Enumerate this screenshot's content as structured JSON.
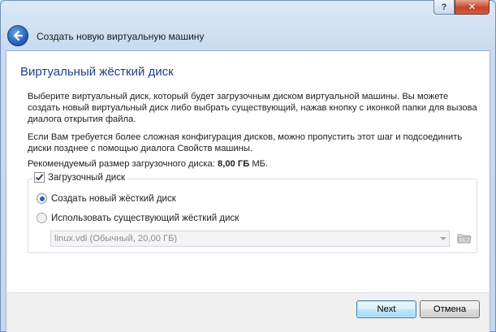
{
  "window": {
    "help_label": "?",
    "close_label": "✕"
  },
  "header": {
    "title": "Создать новую виртуальную машину",
    "back_icon": "back-arrow-icon"
  },
  "page": {
    "title": "Виртуальный жёсткий диск",
    "description1": "Выберите виртуальный диск, который будет загрузочным диском виртуальной машины. Вы можете создать новый виртуальный диск либо выбрать существующий, нажав кнопку с иконкой папки для вызова диалога открытия файла.",
    "description2": "Если Вам требуется более сложная конфигурация дисков, можно пропустить этот шаг и подсоединить диски позднее с помощью диалога Свойств машины.",
    "recommended_prefix": "Рекомендуемый размер загрузочного диска: ",
    "recommended_value": "8,00 ГБ",
    "recommended_suffix": " МБ."
  },
  "boot_group": {
    "checkbox_label": "Загрузочный диск",
    "checked": true,
    "option_create": "Создать новый жёсткий диск",
    "option_existing": "Использовать существующий жёсткий диск",
    "selected_option": "create",
    "combo_value": "linux.vdi (Обычный, 20,00 ГБ)",
    "combo_enabled": false
  },
  "footer": {
    "next_label": "Next",
    "cancel_label": "Отмена"
  },
  "colors": {
    "title_blue": "#1c3f8a",
    "frame": "#c4d7ee",
    "accent": "#2b5fb8"
  }
}
